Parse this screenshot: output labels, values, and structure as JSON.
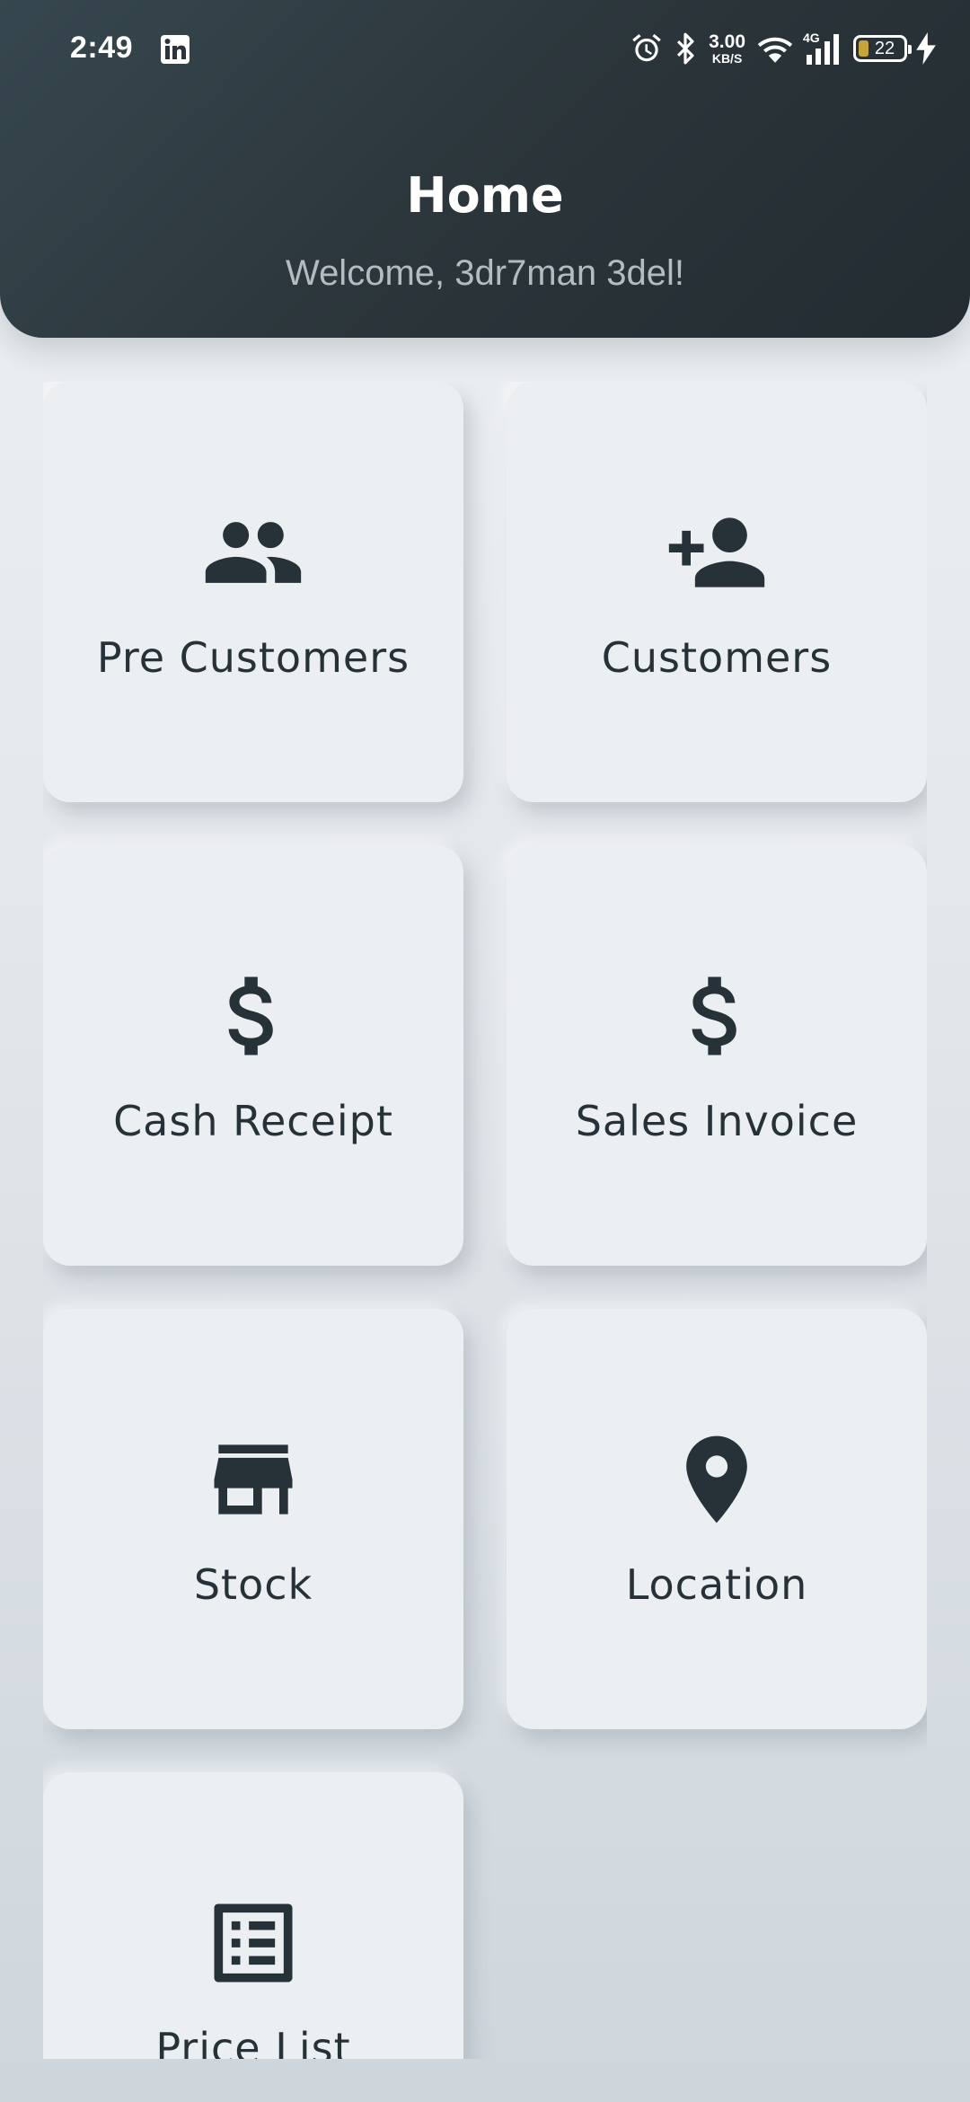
{
  "status_bar": {
    "time": "2:49",
    "net_speed_value": "3.00",
    "net_speed_unit": "KB/S",
    "network_type": "4G",
    "battery_level": "22",
    "icons": [
      "linkedin-icon",
      "alarm-icon",
      "bluetooth-icon",
      "wifi-icon",
      "signal-icon",
      "battery-icon",
      "charging-icon"
    ]
  },
  "header": {
    "title": "Home",
    "welcome": "Welcome, 3dr7man 3del!"
  },
  "colors": {
    "header_bg": "#2a3439",
    "card_bg": "#eceff2",
    "icon_color": "#263238",
    "page_bg": "#e3e7eb",
    "battery_fill": "#c7a43a"
  },
  "menu": {
    "items": [
      {
        "label": "Pre Customers",
        "icon": "people-icon"
      },
      {
        "label": "Customers",
        "icon": "person-add-icon"
      },
      {
        "label": "Cash Receipt",
        "icon": "dollar-icon"
      },
      {
        "label": "Sales Invoice",
        "icon": "dollar-icon"
      },
      {
        "label": "Stock",
        "icon": "store-icon"
      },
      {
        "label": "Location",
        "icon": "location-pin-icon"
      },
      {
        "label": "Price List",
        "icon": "list-alt-icon"
      }
    ]
  }
}
